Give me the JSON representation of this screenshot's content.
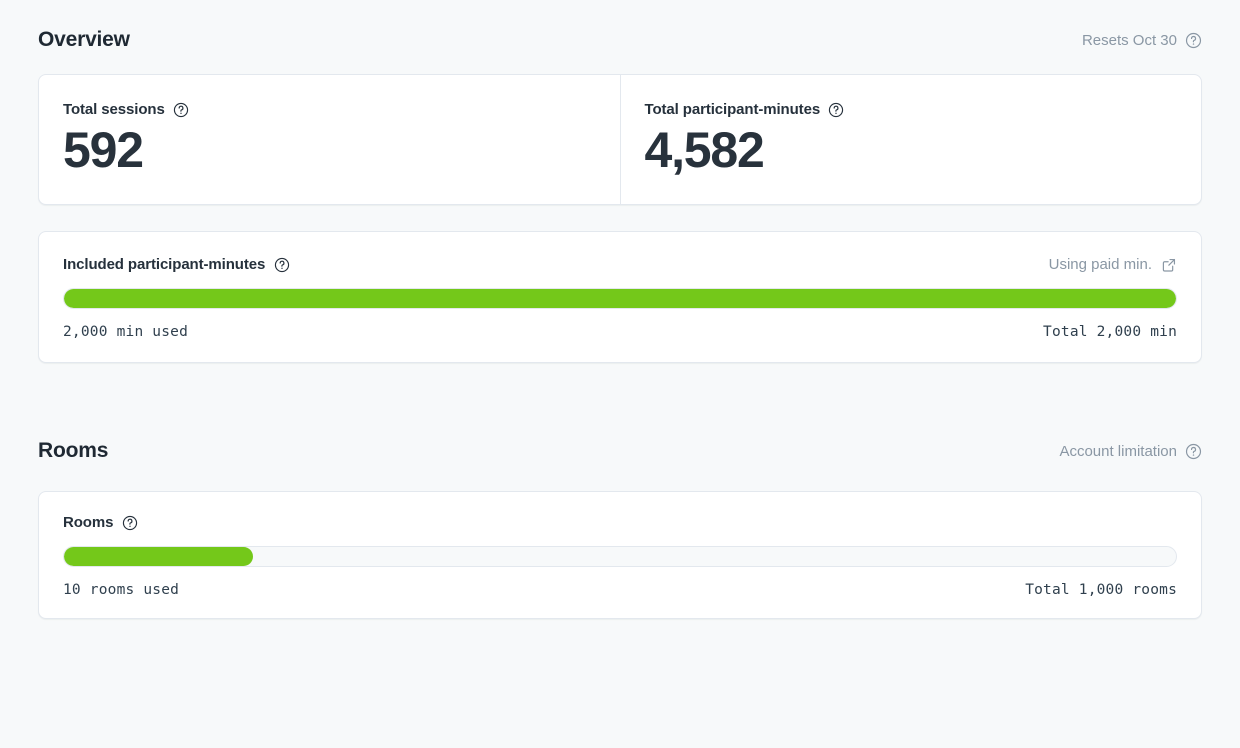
{
  "overview": {
    "title": "Overview",
    "reset_note": "Resets Oct 30",
    "reset_help_icon": "help-circle-icon",
    "stats": [
      {
        "label": "Total sessions",
        "value": "592",
        "help_icon": "help-circle-icon"
      },
      {
        "label": "Total participant-minutes",
        "value": "4,582",
        "help_icon": "help-circle-icon"
      }
    ],
    "usage": {
      "title": "Included participant-minutes",
      "help_icon": "help-circle-icon",
      "link_label": "Using paid min.",
      "link_icon": "external-link-icon",
      "used_label": "2,000 min used",
      "total_label": "Total 2,000 min",
      "percent": 100,
      "fill_color": "#74c81a"
    }
  },
  "rooms": {
    "title": "Rooms",
    "limitation_note": "Account limitation",
    "limitation_help_icon": "help-circle-icon",
    "usage": {
      "title": "Rooms",
      "help_icon": "help-circle-icon",
      "used_label": "10 rooms used",
      "total_label": "Total 1,000 rooms",
      "percent": 17,
      "fill_color": "#74c81a"
    }
  },
  "theme": {
    "background": "#f7f9fa",
    "card_background": "#ffffff",
    "card_border": "#e3e8ee",
    "text_primary": "#26313c",
    "text_muted": "#8a97a4",
    "accent_green": "#74c81a"
  }
}
